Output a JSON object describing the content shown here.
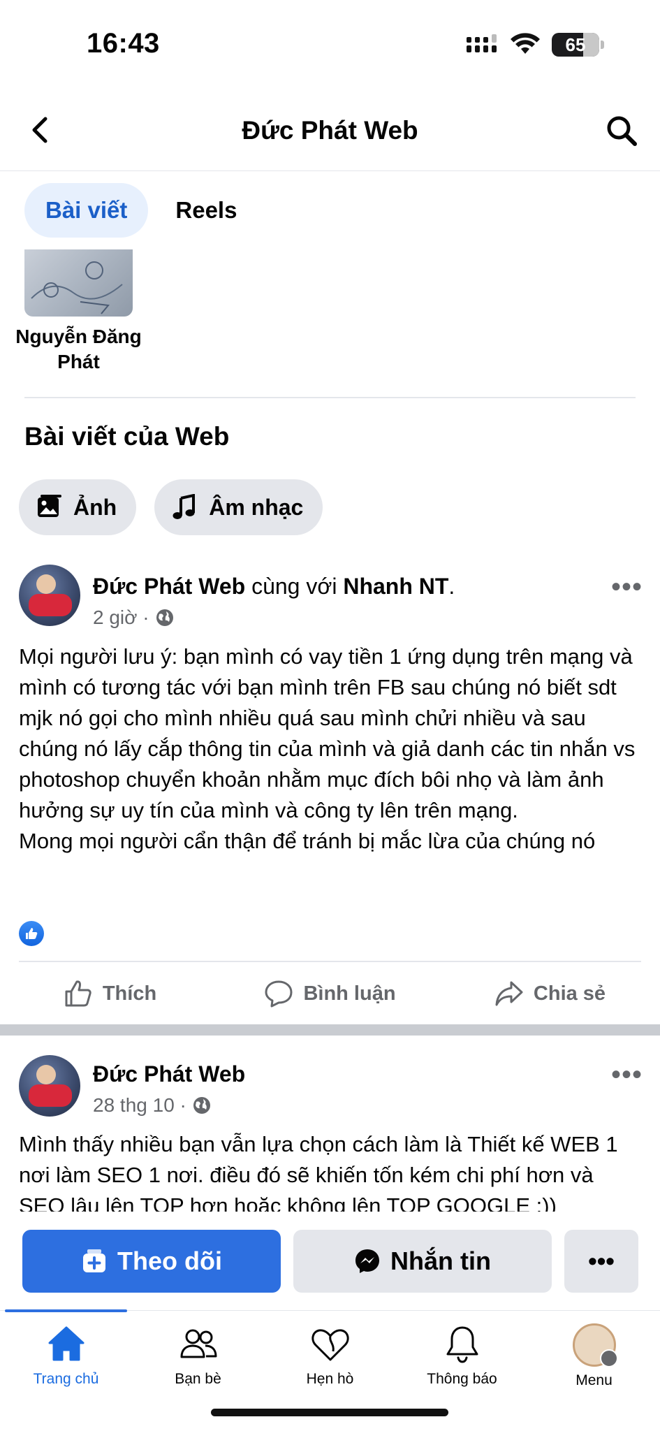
{
  "status_bar": {
    "time": "16:43",
    "battery": "65"
  },
  "nav": {
    "title": "Đức Phát Web"
  },
  "tabs": [
    {
      "label": "Bài viết"
    },
    {
      "label": "Reels"
    }
  ],
  "tagged": {
    "name": "Nguyễn Đăng Phát"
  },
  "section": {
    "title": "Bài viết của Web"
  },
  "chips": [
    {
      "label": "Ảnh",
      "icon": "photo-icon"
    },
    {
      "label": "Âm nhạc",
      "icon": "music-note-icon"
    }
  ],
  "posts": [
    {
      "author": "Đức Phát Web",
      "with_text": "cùng với",
      "tagged": "Nhanh NT",
      "punct": ".",
      "time": "2 giờ ·",
      "text": "Mọi người lưu ý: bạn mình có vay tiền 1 ứng dụng trên mạng và mình có tương tác với bạn mình trên FB sau chúng nó biết sdt mjk nó gọi cho mình nhiều quá sau mình chửi nhiều và sau chúng nó lấy cắp thông tin của mình và giả danh các tin nhắn vs photoshop chuyển khoản nhằm mục đích bôi nhọ và làm ảnh hưởng sự uy tín của mình và công ty lên trên mạng.",
      "text2": "Mong mọi người cẩn thận để tránh bị mắc lừa của chúng nó"
    },
    {
      "author": "Đức Phát Web",
      "time": "28 thg 10 ·",
      "text": "Mình thấy nhiều bạn vẫn lựa chọn cách làm là Thiết kế WEB 1 nơi làm SEO 1 nơi. điều đó sẽ khiến tốn kém chi phí hơn và SEO lâu lên TOP hơn hoặc không lên TOP GOOGLE :))"
    }
  ],
  "post_actions": {
    "like": "Thích",
    "comment": "Bình luận",
    "share": "Chia sẻ"
  },
  "buttons": {
    "follow": "Theo dõi",
    "message": "Nhắn tin",
    "more": "•••"
  },
  "tabbar": [
    {
      "label": "Trang chủ",
      "icon": "home-icon",
      "active": true
    },
    {
      "label": "Bạn bè",
      "icon": "friends-icon"
    },
    {
      "label": "Hẹn hò",
      "icon": "heart-icon"
    },
    {
      "label": "Thông báo",
      "icon": "bell-icon"
    },
    {
      "label": "Menu",
      "icon": "profile-avatar"
    }
  ],
  "colors": {
    "primary": "#2d6fe0",
    "tab_active_bg": "#e7f0fd",
    "chip_bg": "#e4e6eb",
    "secondary_text": "#65676b"
  }
}
